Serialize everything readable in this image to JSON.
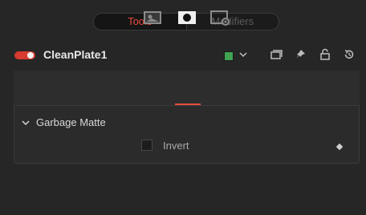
{
  "tabs": {
    "tools": "Tools",
    "modifiers": "Modifiers"
  },
  "tool": {
    "name": "CleanPlate1",
    "accent": "#e64b3d",
    "enable_toggle_color": "#d73a2f",
    "color_swatch": "#3fa353"
  },
  "header_icons": [
    "version-icon",
    "pin-icon",
    "lock-icon",
    "reset-icon"
  ],
  "panel_tabs": [
    "image-icon",
    "mask-icon",
    "settings-icon"
  ],
  "section": {
    "title": "Garbage Matte"
  },
  "controls": {
    "invert_label": "Invert",
    "invert_checked": false
  }
}
